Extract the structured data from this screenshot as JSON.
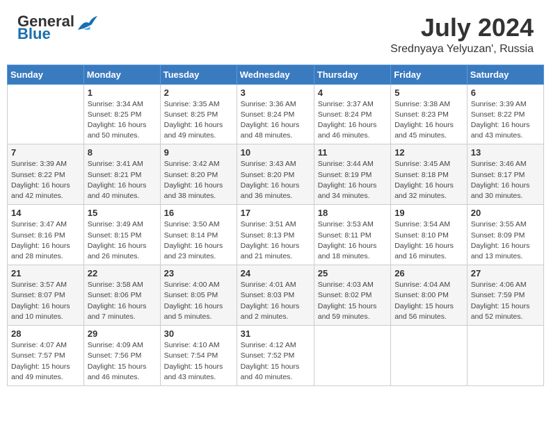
{
  "logo": {
    "general": "General",
    "blue": "Blue"
  },
  "header": {
    "month_year": "July 2024",
    "location": "Srednyaya Yelyuzan', Russia"
  },
  "days_of_week": [
    "Sunday",
    "Monday",
    "Tuesday",
    "Wednesday",
    "Thursday",
    "Friday",
    "Saturday"
  ],
  "weeks": [
    [
      {
        "day": "",
        "info": ""
      },
      {
        "day": "1",
        "info": "Sunrise: 3:34 AM\nSunset: 8:25 PM\nDaylight: 16 hours\nand 50 minutes."
      },
      {
        "day": "2",
        "info": "Sunrise: 3:35 AM\nSunset: 8:25 PM\nDaylight: 16 hours\nand 49 minutes."
      },
      {
        "day": "3",
        "info": "Sunrise: 3:36 AM\nSunset: 8:24 PM\nDaylight: 16 hours\nand 48 minutes."
      },
      {
        "day": "4",
        "info": "Sunrise: 3:37 AM\nSunset: 8:24 PM\nDaylight: 16 hours\nand 46 minutes."
      },
      {
        "day": "5",
        "info": "Sunrise: 3:38 AM\nSunset: 8:23 PM\nDaylight: 16 hours\nand 45 minutes."
      },
      {
        "day": "6",
        "info": "Sunrise: 3:39 AM\nSunset: 8:22 PM\nDaylight: 16 hours\nand 43 minutes."
      }
    ],
    [
      {
        "day": "7",
        "info": "Sunrise: 3:39 AM\nSunset: 8:22 PM\nDaylight: 16 hours\nand 42 minutes."
      },
      {
        "day": "8",
        "info": "Sunrise: 3:41 AM\nSunset: 8:21 PM\nDaylight: 16 hours\nand 40 minutes."
      },
      {
        "day": "9",
        "info": "Sunrise: 3:42 AM\nSunset: 8:20 PM\nDaylight: 16 hours\nand 38 minutes."
      },
      {
        "day": "10",
        "info": "Sunrise: 3:43 AM\nSunset: 8:20 PM\nDaylight: 16 hours\nand 36 minutes."
      },
      {
        "day": "11",
        "info": "Sunrise: 3:44 AM\nSunset: 8:19 PM\nDaylight: 16 hours\nand 34 minutes."
      },
      {
        "day": "12",
        "info": "Sunrise: 3:45 AM\nSunset: 8:18 PM\nDaylight: 16 hours\nand 32 minutes."
      },
      {
        "day": "13",
        "info": "Sunrise: 3:46 AM\nSunset: 8:17 PM\nDaylight: 16 hours\nand 30 minutes."
      }
    ],
    [
      {
        "day": "14",
        "info": "Sunrise: 3:47 AM\nSunset: 8:16 PM\nDaylight: 16 hours\nand 28 minutes."
      },
      {
        "day": "15",
        "info": "Sunrise: 3:49 AM\nSunset: 8:15 PM\nDaylight: 16 hours\nand 26 minutes."
      },
      {
        "day": "16",
        "info": "Sunrise: 3:50 AM\nSunset: 8:14 PM\nDaylight: 16 hours\nand 23 minutes."
      },
      {
        "day": "17",
        "info": "Sunrise: 3:51 AM\nSunset: 8:13 PM\nDaylight: 16 hours\nand 21 minutes."
      },
      {
        "day": "18",
        "info": "Sunrise: 3:53 AM\nSunset: 8:11 PM\nDaylight: 16 hours\nand 18 minutes."
      },
      {
        "day": "19",
        "info": "Sunrise: 3:54 AM\nSunset: 8:10 PM\nDaylight: 16 hours\nand 16 minutes."
      },
      {
        "day": "20",
        "info": "Sunrise: 3:55 AM\nSunset: 8:09 PM\nDaylight: 16 hours\nand 13 minutes."
      }
    ],
    [
      {
        "day": "21",
        "info": "Sunrise: 3:57 AM\nSunset: 8:07 PM\nDaylight: 16 hours\nand 10 minutes."
      },
      {
        "day": "22",
        "info": "Sunrise: 3:58 AM\nSunset: 8:06 PM\nDaylight: 16 hours\nand 7 minutes."
      },
      {
        "day": "23",
        "info": "Sunrise: 4:00 AM\nSunset: 8:05 PM\nDaylight: 16 hours\nand 5 minutes."
      },
      {
        "day": "24",
        "info": "Sunrise: 4:01 AM\nSunset: 8:03 PM\nDaylight: 16 hours\nand 2 minutes."
      },
      {
        "day": "25",
        "info": "Sunrise: 4:03 AM\nSunset: 8:02 PM\nDaylight: 15 hours\nand 59 minutes."
      },
      {
        "day": "26",
        "info": "Sunrise: 4:04 AM\nSunset: 8:00 PM\nDaylight: 15 hours\nand 56 minutes."
      },
      {
        "day": "27",
        "info": "Sunrise: 4:06 AM\nSunset: 7:59 PM\nDaylight: 15 hours\nand 52 minutes."
      }
    ],
    [
      {
        "day": "28",
        "info": "Sunrise: 4:07 AM\nSunset: 7:57 PM\nDaylight: 15 hours\nand 49 minutes."
      },
      {
        "day": "29",
        "info": "Sunrise: 4:09 AM\nSunset: 7:56 PM\nDaylight: 15 hours\nand 46 minutes."
      },
      {
        "day": "30",
        "info": "Sunrise: 4:10 AM\nSunset: 7:54 PM\nDaylight: 15 hours\nand 43 minutes."
      },
      {
        "day": "31",
        "info": "Sunrise: 4:12 AM\nSunset: 7:52 PM\nDaylight: 15 hours\nand 40 minutes."
      },
      {
        "day": "",
        "info": ""
      },
      {
        "day": "",
        "info": ""
      },
      {
        "day": "",
        "info": ""
      }
    ]
  ]
}
